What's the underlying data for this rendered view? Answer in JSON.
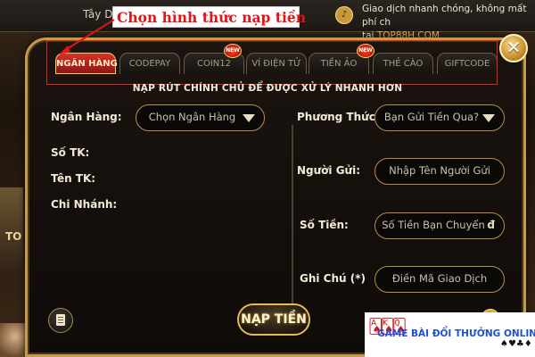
{
  "topbar": {
    "left_text": "Tây Du",
    "news_line1": "Giao dịch nhanh chóng, không mất phí ch",
    "news_line2_prefix": "tại ",
    "news_link": "TOP88H.COM"
  },
  "annotation": {
    "label": "Chọn hình thức nạp tiền",
    "color": "#e21515"
  },
  "dialog": {
    "close_label": "✕",
    "tabs": [
      {
        "label": "NGÂN HÀNG",
        "active": true,
        "new": false
      },
      {
        "label": "CODEPAY",
        "active": false,
        "new": false
      },
      {
        "label": "COIN12",
        "active": false,
        "new": true
      },
      {
        "label": "VÍ ĐIỆN TỬ",
        "active": false,
        "new": false
      },
      {
        "label": "TIỀN ẢO",
        "active": false,
        "new": true
      },
      {
        "label": "THẺ CÀO",
        "active": false,
        "new": false
      },
      {
        "label": "GIFTCODE",
        "active": false,
        "new": false
      }
    ],
    "new_badge": "NEW",
    "subtitle": "NẠP RÚT CHÍNH CHỦ ĐỂ ĐƯỢC XỬ LÝ NHANH HƠN",
    "left": {
      "bank_label": "Ngân Hàng:",
      "bank_select": "Chọn Ngân Hàng",
      "account_no_label": "Số TK:",
      "account_name_label": "Tên TK:",
      "branch_label": "Chi Nhánh:"
    },
    "right": {
      "method_label": "Phương Thức:",
      "method_select": "Bạn Gửi Tiền Qua?",
      "sender_label": "Người Gửi:",
      "sender_placeholder": "Nhập Tên Người Gửi",
      "amount_label": "Số Tiền:",
      "amount_placeholder": "Số Tiền Bạn Chuyển",
      "currency": "đ",
      "note_label": "Ghi Chú (*)",
      "note_placeholder": "Điền Mã Giao Dịch"
    },
    "submit_label": "NẠP TIỀN"
  },
  "promo": {
    "text": "GAME BÀI ĐỔI THƯỞNG ONLINE",
    "cards": "🂡🂮🂭",
    "suits": "♠♥♣♦"
  },
  "left_edge": {
    "text": "TO"
  },
  "colors": {
    "gold": "#c49a4c",
    "active_tab": "#d3342a",
    "annotation_red": "#e02424"
  }
}
